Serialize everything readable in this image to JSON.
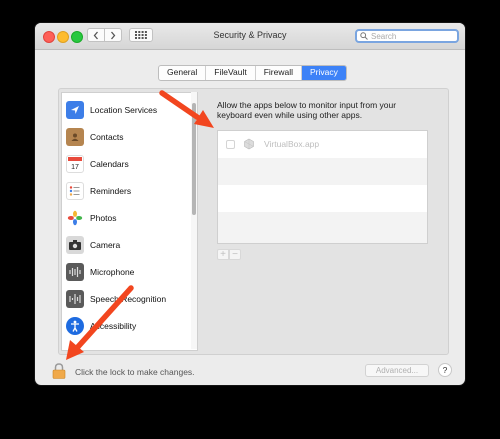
{
  "window": {
    "title": "Security & Privacy",
    "search_placeholder": "Search"
  },
  "tabs": [
    {
      "label": "General",
      "active": false
    },
    {
      "label": "FileVault",
      "active": false
    },
    {
      "label": "Firewall",
      "active": false
    },
    {
      "label": "Privacy",
      "active": true
    }
  ],
  "sidebar": {
    "items": [
      {
        "label": "Location Services",
        "icon": "location-arrow-icon",
        "color": "#3d7ee8"
      },
      {
        "label": "Contacts",
        "icon": "contacts-book-icon",
        "color": "#b58550"
      },
      {
        "label": "Calendars",
        "icon": "calendar-icon",
        "color": "#ffffff"
      },
      {
        "label": "Reminders",
        "icon": "reminders-list-icon",
        "color": "#ffffff"
      },
      {
        "label": "Photos",
        "icon": "photos-flower-icon",
        "color": "#ffffff"
      },
      {
        "label": "Camera",
        "icon": "camera-icon",
        "color": "#4a4a4a"
      },
      {
        "label": "Microphone",
        "icon": "microphone-waveform-icon",
        "color": "#5a5a5a"
      },
      {
        "label": "Speech Recognition",
        "icon": "speech-waveform-icon",
        "color": "#5a5a5a"
      },
      {
        "label": "Accessibility",
        "icon": "accessibility-person-icon",
        "color": "#1e6be0"
      }
    ]
  },
  "panel": {
    "description": "Allow the apps below to monitor input from your keyboard even while using other apps.",
    "apps": [
      {
        "name": "VirtualBox.app",
        "checked": false
      }
    ],
    "add_label": "+",
    "remove_label": "−"
  },
  "footer": {
    "lock_text": "Click the lock to make changes.",
    "advanced_label": "Advanced...",
    "help_label": "?"
  },
  "colors": {
    "accent": "#3d82f7",
    "arrow": "#f2461f",
    "lock": "#f0a94a"
  }
}
